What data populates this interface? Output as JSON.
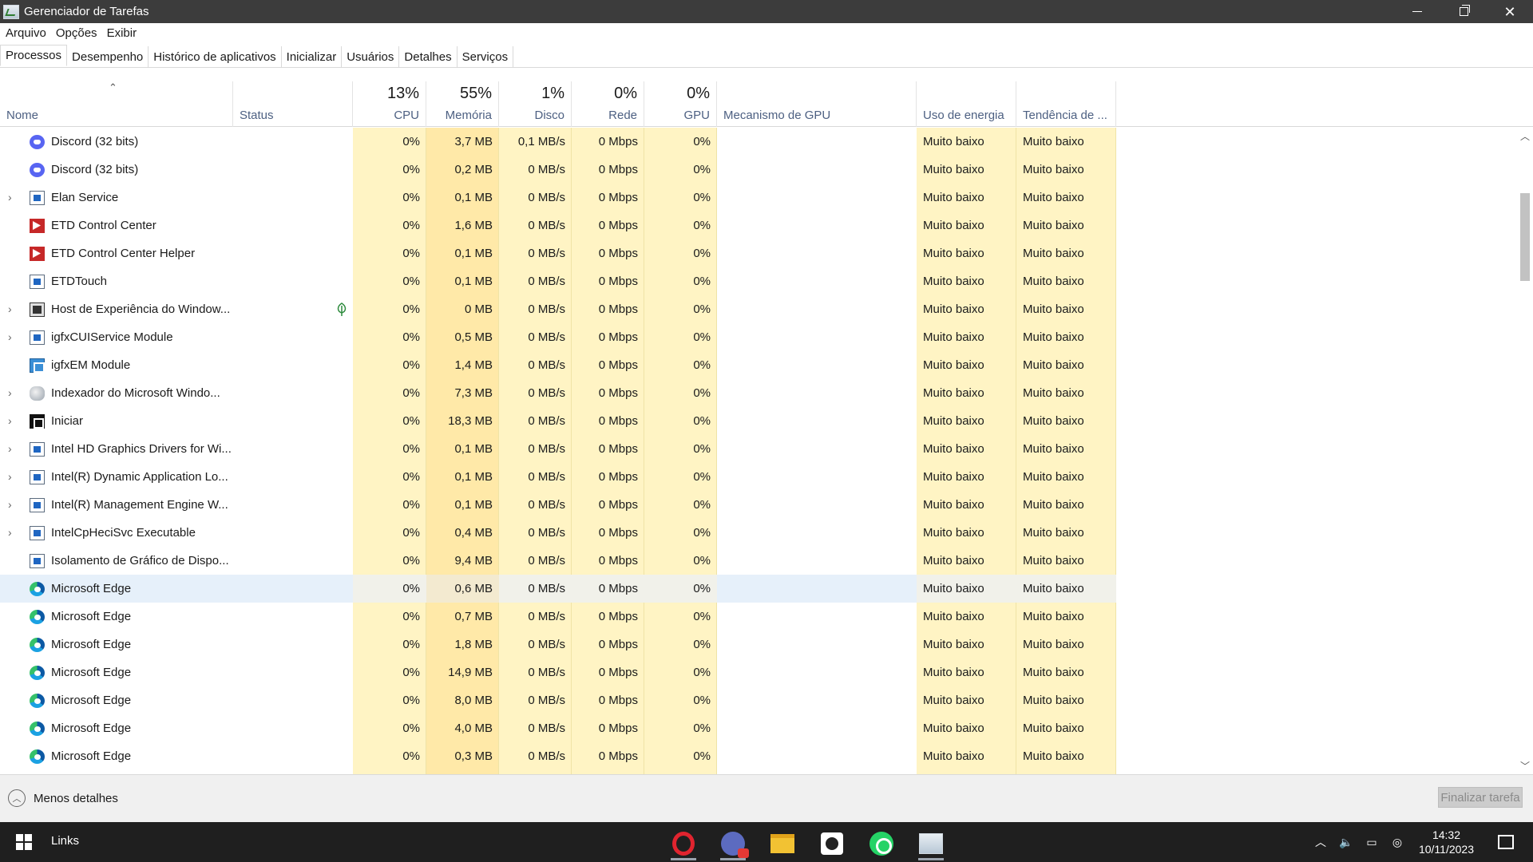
{
  "window": {
    "title": "Gerenciador de Tarefas",
    "min_glyph": "",
    "close_glyph": "✕"
  },
  "menu": [
    "Arquivo",
    "Opções",
    "Exibir"
  ],
  "tabs": [
    "Processos",
    "Desempenho",
    "Histórico de aplicativos",
    "Inicializar",
    "Usuários",
    "Detalhes",
    "Serviços"
  ],
  "header": {
    "name": "Nome",
    "status": "Status",
    "cpu": {
      "pct": "13%",
      "label": "CPU"
    },
    "memory": {
      "pct": "55%",
      "label": "Memória"
    },
    "disk": {
      "pct": "1%",
      "label": "Disco"
    },
    "network": {
      "pct": "0%",
      "label": "Rede"
    },
    "gpu": {
      "pct": "0%",
      "label": "GPU"
    },
    "gpu_engine": "Mecanismo de GPU",
    "power": "Uso de energia",
    "power_trend": "Tendência de ..."
  },
  "rows": [
    {
      "name": "Discord (32 bits)",
      "icon": "discord-icon",
      "expand": false,
      "leaf": false,
      "cpu": "0%",
      "mem": "3,7 MB",
      "disk": "0,1 MB/s",
      "net": "0 Mbps",
      "gpu": "0%",
      "power": "Muito baixo",
      "trend": "Muito baixo"
    },
    {
      "name": "Discord (32 bits)",
      "icon": "discord-icon",
      "expand": false,
      "leaf": false,
      "cpu": "0%",
      "mem": "0,2 MB",
      "disk": "0 MB/s",
      "net": "0 Mbps",
      "gpu": "0%",
      "power": "Muito baixo",
      "trend": "Muito baixo"
    },
    {
      "name": "Elan Service",
      "icon": "app-icon",
      "expand": true,
      "leaf": false,
      "cpu": "0%",
      "mem": "0,1 MB",
      "disk": "0 MB/s",
      "net": "0 Mbps",
      "gpu": "0%",
      "power": "Muito baixo",
      "trend": "Muito baixo"
    },
    {
      "name": "ETD Control Center",
      "icon": "etd-icon",
      "expand": false,
      "leaf": false,
      "cpu": "0%",
      "mem": "1,6 MB",
      "disk": "0 MB/s",
      "net": "0 Mbps",
      "gpu": "0%",
      "power": "Muito baixo",
      "trend": "Muito baixo"
    },
    {
      "name": "ETD Control Center Helper",
      "icon": "etd-icon",
      "expand": false,
      "leaf": false,
      "cpu": "0%",
      "mem": "0,1 MB",
      "disk": "0 MB/s",
      "net": "0 Mbps",
      "gpu": "0%",
      "power": "Muito baixo",
      "trend": "Muito baixo"
    },
    {
      "name": "ETDTouch",
      "icon": "app-icon",
      "expand": false,
      "leaf": false,
      "cpu": "0%",
      "mem": "0,1 MB",
      "disk": "0 MB/s",
      "net": "0 Mbps",
      "gpu": "0%",
      "power": "Muito baixo",
      "trend": "Muito baixo"
    },
    {
      "name": "Host de Experiência do Window...",
      "icon": "host-icon",
      "expand": true,
      "leaf": true,
      "cpu": "0%",
      "mem": "0 MB",
      "disk": "0 MB/s",
      "net": "0 Mbps",
      "gpu": "0%",
      "power": "Muito baixo",
      "trend": "Muito baixo"
    },
    {
      "name": "igfxCUIService Module",
      "icon": "app-icon",
      "expand": true,
      "leaf": false,
      "cpu": "0%",
      "mem": "0,5 MB",
      "disk": "0 MB/s",
      "net": "0 Mbps",
      "gpu": "0%",
      "power": "Muito baixo",
      "trend": "Muito baixo"
    },
    {
      "name": "igfxEM Module",
      "icon": "igfx-icon",
      "expand": false,
      "leaf": false,
      "cpu": "0%",
      "mem": "1,4 MB",
      "disk": "0 MB/s",
      "net": "0 Mbps",
      "gpu": "0%",
      "power": "Muito baixo",
      "trend": "Muito baixo"
    },
    {
      "name": "Indexador do Microsoft Windo...",
      "icon": "indexer-icon",
      "expand": true,
      "leaf": false,
      "cpu": "0%",
      "mem": "7,3 MB",
      "disk": "0 MB/s",
      "net": "0 Mbps",
      "gpu": "0%",
      "power": "Muito baixo",
      "trend": "Muito baixo"
    },
    {
      "name": "Iniciar",
      "icon": "iniciar-icon",
      "expand": true,
      "leaf": false,
      "cpu": "0%",
      "mem": "18,3 MB",
      "disk": "0 MB/s",
      "net": "0 Mbps",
      "gpu": "0%",
      "power": "Muito baixo",
      "trend": "Muito baixo"
    },
    {
      "name": "Intel HD Graphics Drivers for Wi...",
      "icon": "app-icon",
      "expand": true,
      "leaf": false,
      "cpu": "0%",
      "mem": "0,1 MB",
      "disk": "0 MB/s",
      "net": "0 Mbps",
      "gpu": "0%",
      "power": "Muito baixo",
      "trend": "Muito baixo"
    },
    {
      "name": "Intel(R) Dynamic Application Lo...",
      "icon": "app-icon",
      "expand": true,
      "leaf": false,
      "cpu": "0%",
      "mem": "0,1 MB",
      "disk": "0 MB/s",
      "net": "0 Mbps",
      "gpu": "0%",
      "power": "Muito baixo",
      "trend": "Muito baixo"
    },
    {
      "name": "Intel(R) Management Engine W...",
      "icon": "app-icon",
      "expand": true,
      "leaf": false,
      "cpu": "0%",
      "mem": "0,1 MB",
      "disk": "0 MB/s",
      "net": "0 Mbps",
      "gpu": "0%",
      "power": "Muito baixo",
      "trend": "Muito baixo"
    },
    {
      "name": "IntelCpHeciSvc Executable",
      "icon": "app-icon",
      "expand": true,
      "leaf": false,
      "cpu": "0%",
      "mem": "0,4 MB",
      "disk": "0 MB/s",
      "net": "0 Mbps",
      "gpu": "0%",
      "power": "Muito baixo",
      "trend": "Muito baixo"
    },
    {
      "name": "Isolamento de Gráfico de Dispo...",
      "icon": "app-icon",
      "expand": false,
      "leaf": false,
      "cpu": "0%",
      "mem": "9,4 MB",
      "disk": "0 MB/s",
      "net": "0 Mbps",
      "gpu": "0%",
      "power": "Muito baixo",
      "trend": "Muito baixo"
    },
    {
      "name": "Microsoft Edge",
      "icon": "edge-icon",
      "expand": false,
      "leaf": false,
      "selected": true,
      "cpu": "0%",
      "mem": "0,6 MB",
      "disk": "0 MB/s",
      "net": "0 Mbps",
      "gpu": "0%",
      "power": "Muito baixo",
      "trend": "Muito baixo"
    },
    {
      "name": "Microsoft Edge",
      "icon": "edge-icon",
      "expand": false,
      "leaf": false,
      "cpu": "0%",
      "mem": "0,7 MB",
      "disk": "0 MB/s",
      "net": "0 Mbps",
      "gpu": "0%",
      "power": "Muito baixo",
      "trend": "Muito baixo"
    },
    {
      "name": "Microsoft Edge",
      "icon": "edge-icon",
      "expand": false,
      "leaf": false,
      "cpu": "0%",
      "mem": "1,8 MB",
      "disk": "0 MB/s",
      "net": "0 Mbps",
      "gpu": "0%",
      "power": "Muito baixo",
      "trend": "Muito baixo"
    },
    {
      "name": "Microsoft Edge",
      "icon": "edge-icon",
      "expand": false,
      "leaf": false,
      "cpu": "0%",
      "mem": "14,9 MB",
      "disk": "0 MB/s",
      "net": "0 Mbps",
      "gpu": "0%",
      "power": "Muito baixo",
      "trend": "Muito baixo"
    },
    {
      "name": "Microsoft Edge",
      "icon": "edge-icon",
      "expand": false,
      "leaf": false,
      "cpu": "0%",
      "mem": "8,0 MB",
      "disk": "0 MB/s",
      "net": "0 Mbps",
      "gpu": "0%",
      "power": "Muito baixo",
      "trend": "Muito baixo"
    },
    {
      "name": "Microsoft Edge",
      "icon": "edge-icon",
      "expand": false,
      "leaf": false,
      "cpu": "0%",
      "mem": "4,0 MB",
      "disk": "0 MB/s",
      "net": "0 Mbps",
      "gpu": "0%",
      "power": "Muito baixo",
      "trend": "Muito baixo"
    },
    {
      "name": "Microsoft Edge",
      "icon": "edge-icon",
      "expand": false,
      "leaf": false,
      "cpu": "0%",
      "mem": "0,3 MB",
      "disk": "0 MB/s",
      "net": "0 Mbps",
      "gpu": "0%",
      "power": "Muito baixo",
      "trend": "Muito baixo"
    }
  ],
  "footer": {
    "less_details": "Menos detalhes",
    "end_task": "Finalizar tarefa"
  },
  "taskbar": {
    "links": "Links",
    "time": "14:32",
    "date": "10/11/2023",
    "apps": [
      "opera-icon",
      "messenger-icon",
      "file-explorer-icon",
      "chatgpt-icon",
      "whatsapp-icon",
      "task-manager-icon"
    ]
  },
  "colors": {
    "heat_light": "#fff4c4",
    "heat_medium": "#ffe9a8",
    "selected_row": "#e6f0fa",
    "header_label": "#4d6082"
  }
}
